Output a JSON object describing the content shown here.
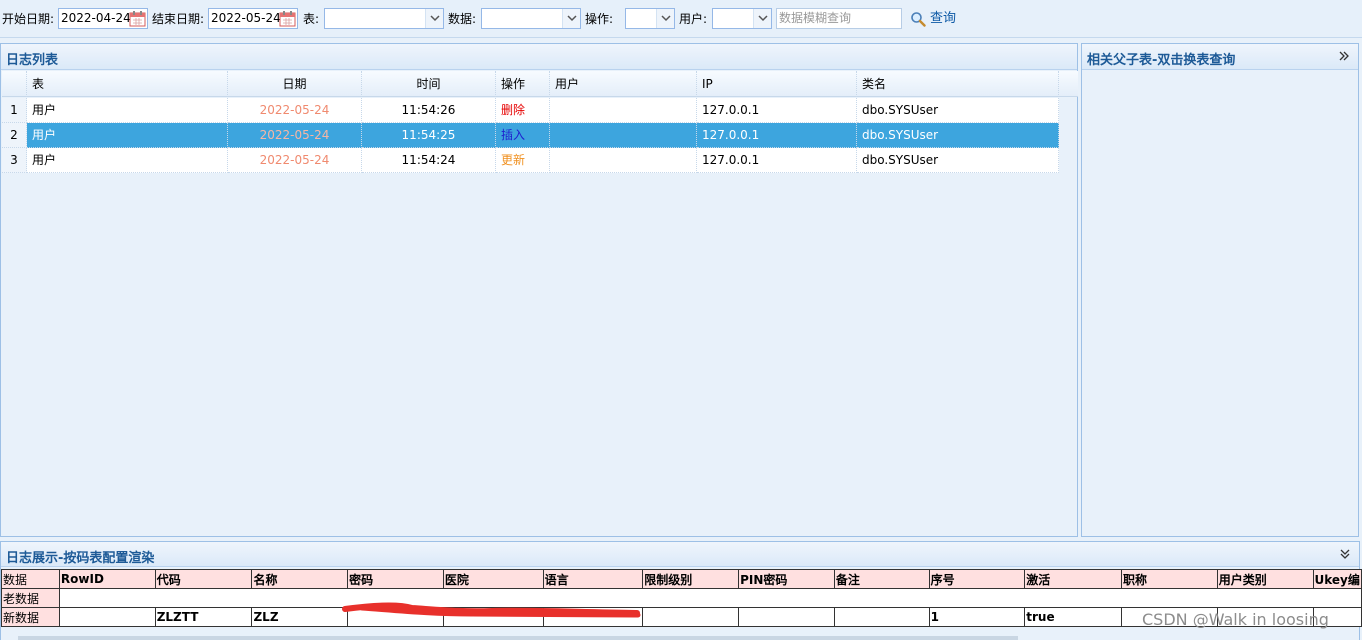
{
  "toolbar": {
    "start_date_label": "开始日期:",
    "start_date_value": "2022-04-24",
    "end_date_label": "结束日期:",
    "end_date_value": "2022-05-24",
    "table_label": "表:",
    "data_label": "数据:",
    "operation_label": "操作:",
    "user_label": "用户:",
    "search_placeholder": "数据模糊查询",
    "search_button": "查询"
  },
  "log_panel": {
    "title": "日志列表",
    "columns": [
      "表",
      "日期",
      "时间",
      "操作",
      "用户",
      "IP",
      "类名"
    ],
    "rows": [
      {
        "num": "1",
        "table": "用户",
        "date": "2022-05-24",
        "time": "11:54:26",
        "op": "删除",
        "op_color": "#e60000",
        "user": "",
        "ip": "127.0.0.1",
        "class": "dbo.SYSUser"
      },
      {
        "num": "2",
        "table": "用户",
        "date": "2022-05-24",
        "time": "11:54:25",
        "op": "插入",
        "op_color": "#1f1fcf",
        "user": "",
        "ip": "127.0.0.1",
        "class": "dbo.SYSUser"
      },
      {
        "num": "3",
        "table": "用户",
        "date": "2022-05-24",
        "time": "11:54:24",
        "op": "更新",
        "op_color": "#f0901f",
        "user": "",
        "ip": "127.0.0.1",
        "class": "dbo.SYSUser"
      }
    ],
    "selected_row": 2
  },
  "related_panel": {
    "title": "相关父子表-双击换表查询"
  },
  "detail_panel": {
    "title": "日志展示-按码表配置渲染",
    "columns": [
      "数据",
      "RowID",
      "代码",
      "名称",
      "密码",
      "医院",
      "语言",
      "限制级别",
      "PIN密码",
      "备注",
      "序号",
      "激活",
      "职称",
      "用户类别",
      "Ukey编"
    ],
    "rows": [
      {
        "label": "老数据",
        "cells": [
          "",
          "",
          "",
          "",
          "",
          "",
          "",
          "",
          "",
          "",
          "",
          "",
          "",
          ""
        ]
      },
      {
        "label": "新数据",
        "cells": [
          "",
          "ZLZTT",
          "ZLZ",
          "",
          "",
          "",
          "",
          "",
          "",
          "1",
          "true",
          "",
          "",
          ""
        ]
      }
    ]
  },
  "watermark": "CSDN @Walk in loosing",
  "colors": {
    "accent": "#1d5a97",
    "selected_row": "#3da5de",
    "date_text": "#f08a6f",
    "header_pink": "#ffe0e0"
  }
}
